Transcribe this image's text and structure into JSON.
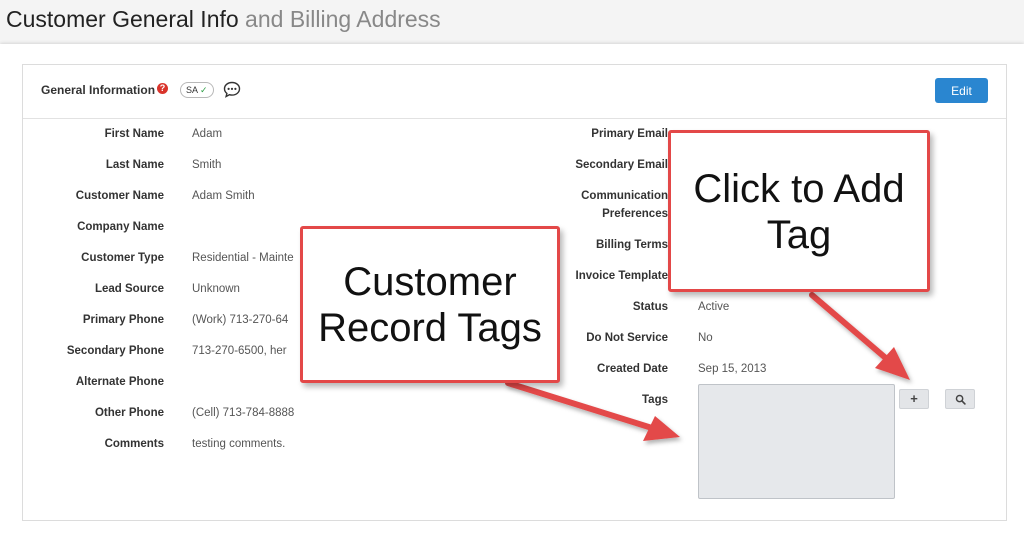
{
  "page": {
    "title_strong": "Customer General Info",
    "title_light": " and Billing Address"
  },
  "panel": {
    "title": "General Information",
    "help_icon_glyph": "?",
    "badge_label": "SA",
    "badge_check": "✓",
    "edit_label": "Edit"
  },
  "left_fields": [
    {
      "label": "First Name",
      "value": "Adam"
    },
    {
      "label": "Last Name",
      "value": "Smith"
    },
    {
      "label": "Customer Name",
      "value": "Adam Smith"
    },
    {
      "label": "Company Name",
      "value": ""
    },
    {
      "label": "Customer Type",
      "value": "Residential - Mainte"
    },
    {
      "label": "Lead Source",
      "value": "Unknown"
    },
    {
      "label": "Primary Phone",
      "value": "(Work) 713-270-64"
    },
    {
      "label": "Secondary Phone",
      "value": "713-270-6500, her"
    },
    {
      "label": "Alternate Phone",
      "value": ""
    },
    {
      "label": "Other Phone",
      "value": "(Cell) 713-784-8888"
    },
    {
      "label": "Comments",
      "value": "testing comments."
    }
  ],
  "right_fields": {
    "primary_email": {
      "label": "Primary Email",
      "value": ""
    },
    "secondary_email": {
      "label": "Secondary Email",
      "value": ""
    },
    "communication_line1": "Communication",
    "communication_line2": "Preferences",
    "billing_terms": {
      "label": "Billing Terms",
      "value": ""
    },
    "invoice_template": {
      "label": "Invoice Template",
      "value": ""
    },
    "status": {
      "label": "Status",
      "value": "Active"
    },
    "do_not_service": {
      "label": "Do Not Service",
      "value": "No"
    },
    "created_date": {
      "label": "Created Date",
      "value": "Sep 15, 2013"
    },
    "tags": {
      "label": "Tags"
    }
  },
  "tag_buttons": {
    "add_glyph": "+"
  },
  "callouts": {
    "record_tags_line1": "Customer",
    "record_tags_line2": "Record Tags",
    "add_tag_line1": "Click to Add",
    "add_tag_line2": "Tag"
  },
  "colors": {
    "accent": "#2a86d0",
    "callout_border": "#e34848",
    "help_red": "#d9342b",
    "check_green": "#2e9e45"
  },
  "icons": {
    "help": "question-circle-icon",
    "chat": "chat-bubble-dots-icon",
    "add": "plus-icon",
    "search": "magnifier-icon"
  }
}
